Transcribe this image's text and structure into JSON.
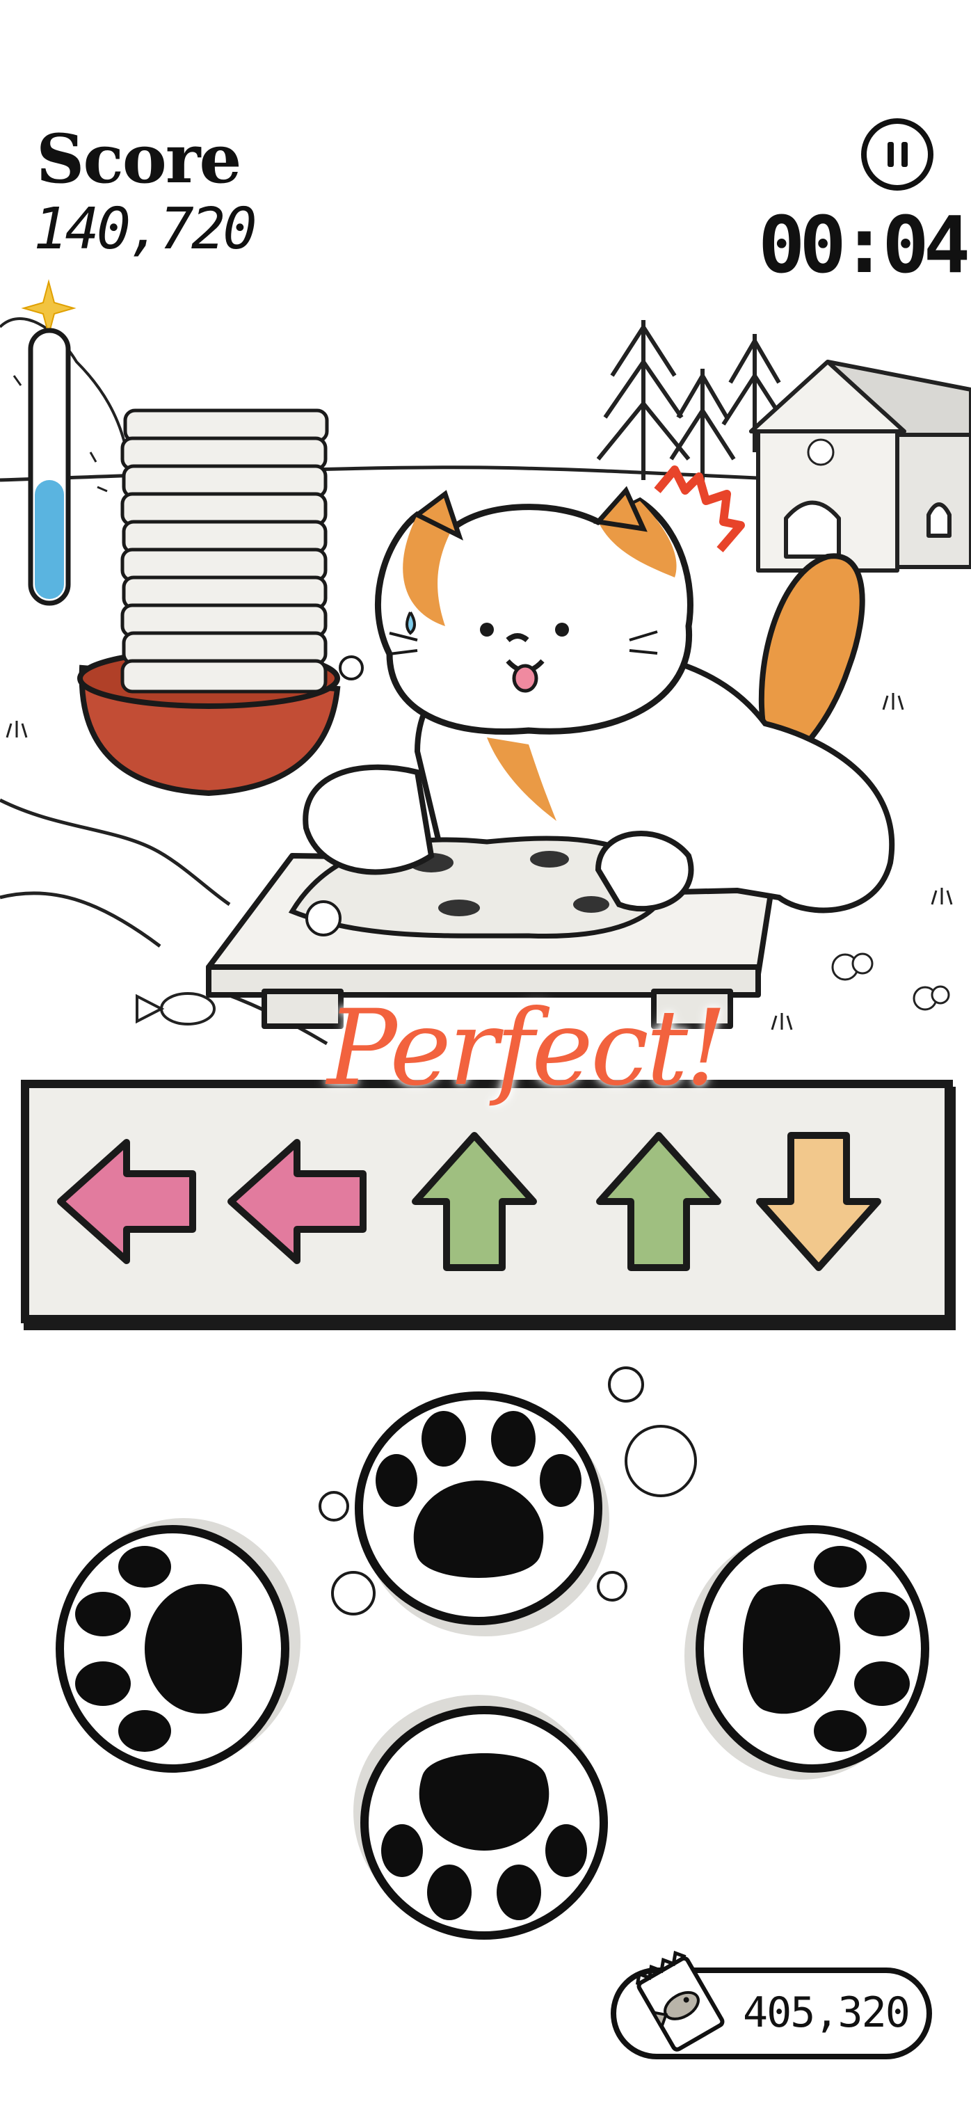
{
  "hud": {
    "score_label": "Score",
    "score_value": "140,720",
    "timer": "00:04",
    "pause_icon": "pause-icon",
    "combo_meter_level": 0.45,
    "combo_meter_color": "#5ab4e0"
  },
  "feedback": {
    "text": "Perfect!",
    "color": "#f2623e"
  },
  "arrow_sequence": [
    {
      "direction": "left",
      "color": "#e27b9e"
    },
    {
      "direction": "left",
      "color": "#e27b9e"
    },
    {
      "direction": "up",
      "color": "#9fbf80"
    },
    {
      "direction": "up",
      "color": "#9fbf80"
    },
    {
      "direction": "down",
      "color": "#f2c88c"
    }
  ],
  "paw_buttons": [
    "up",
    "left",
    "right",
    "down"
  ],
  "currency": {
    "icon": "fish-snack-icon",
    "value": "405,320"
  }
}
